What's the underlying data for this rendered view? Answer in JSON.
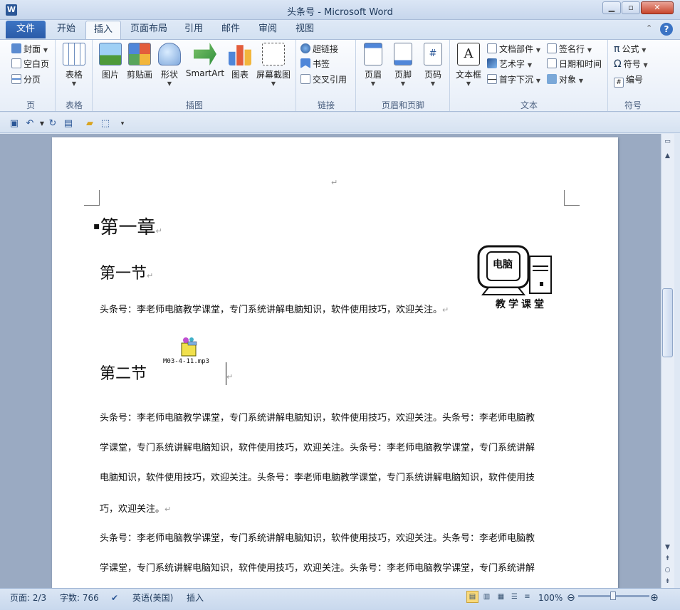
{
  "window": {
    "title": "头条号 - Microsoft Word",
    "min": "▁",
    "max": "▫",
    "close": "✕"
  },
  "tabs": [
    {
      "label": "文件"
    },
    {
      "label": "开始"
    },
    {
      "label": "插入"
    },
    {
      "label": "页面布局"
    },
    {
      "label": "引用"
    },
    {
      "label": "邮件"
    },
    {
      "label": "审阅"
    },
    {
      "label": "视图"
    }
  ],
  "active_tab": "插入",
  "ribbon": {
    "pages": {
      "label": "页",
      "items": [
        "封面",
        "空白页",
        "分页"
      ]
    },
    "tables": {
      "label": "表格",
      "button": "表格"
    },
    "illustrations": {
      "label": "插图",
      "buttons": [
        "图片",
        "剪贴画",
        "形状",
        "SmartArt",
        "图表",
        "屏幕截图"
      ]
    },
    "links": {
      "label": "链接",
      "items": [
        "超链接",
        "书签",
        "交叉引用"
      ]
    },
    "header_footer": {
      "label": "页眉和页脚",
      "buttons": [
        "页眉",
        "页脚",
        "页码"
      ]
    },
    "text": {
      "label": "文本",
      "button": "文本框",
      "col1": [
        "文档部件",
        "艺术字",
        "首字下沉"
      ],
      "col2": [
        "签名行",
        "日期和时间",
        "对象"
      ]
    },
    "symbols": {
      "label": "符号",
      "items": [
        "公式",
        "符号",
        "编号"
      ]
    }
  },
  "document": {
    "chapter": "第一章",
    "section1": "第一节",
    "para1": "头条号：李老师电脑教学课堂，专门系统讲解电脑知识，软件使用技巧，欢迎关注。",
    "logo_top": "电脑",
    "logo_caption": "教学课堂",
    "attachment": "M03-4-11.mp3",
    "section2": "第二节",
    "body_lines": [
      "头条号：李老师电脑教学课堂，专门系统讲解电脑知识，软件使用技巧，欢迎关注。头条号：李老师电脑教",
      "学课堂，专门系统讲解电脑知识，软件使用技巧，欢迎关注。头条号：李老师电脑教学课堂，专门系统讲解",
      "电脑知识，软件使用技巧，欢迎关注。头条号：李老师电脑教学课堂，专门系统讲解电脑知识，软件使用技",
      "巧，欢迎关注。",
      "头条号：李老师电脑教学课堂，专门系统讲解电脑知识，软件使用技巧，欢迎关注。头条号：李老师电脑教",
      "学课堂，专门系统讲解电脑知识，软件使用技巧，欢迎关注。头条号：李老师电脑教学课堂，专门系统讲解"
    ],
    "para_mark": "↵"
  },
  "status": {
    "page": "页面: 2/3",
    "words": "字数: 766",
    "language": "英语(美国)",
    "mode": "插入",
    "zoom": "100%"
  },
  "colors": {
    "accent": "#2b5797",
    "file_tab": "#2b5ca8"
  }
}
